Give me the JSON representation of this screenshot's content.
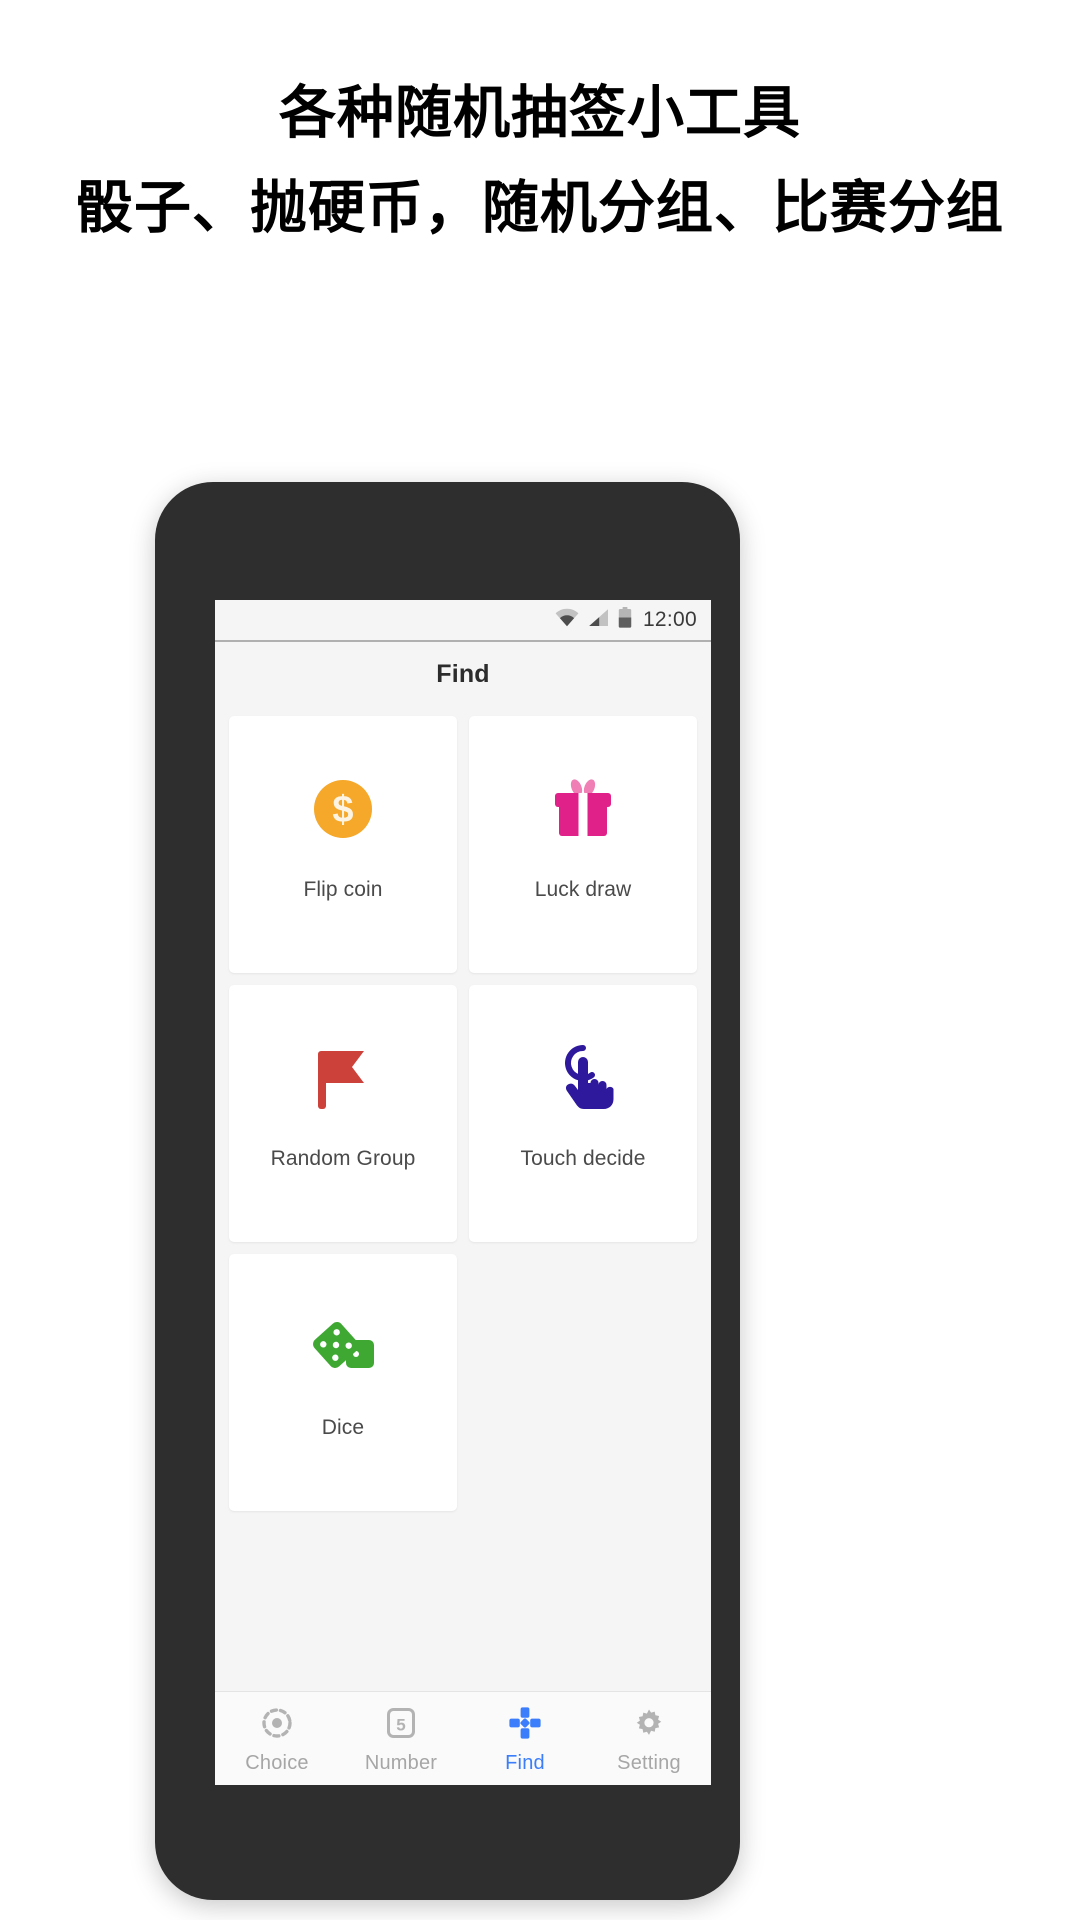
{
  "promo": {
    "line1": "各种随机抽签小工具",
    "line2": "骰子、抛硬币，随机分组、比赛分组"
  },
  "phone": {
    "statusbar": {
      "wifi_icon": "wifi-icon",
      "signal_icon": "signal-icon",
      "battery_icon": "battery-icon",
      "time": "12:00"
    },
    "appbar": {
      "title": "Find"
    },
    "grid": {
      "cards": [
        {
          "label": "Flip coin",
          "icon": "coin-dollar-icon",
          "color": "#f5a829"
        },
        {
          "label": "Luck draw",
          "icon": "gift-box-icon",
          "color": "#e0218a"
        },
        {
          "label": "Random Group",
          "icon": "flag-icon",
          "color": "#cc4139"
        },
        {
          "label": "Touch decide",
          "icon": "touch-hand-icon",
          "color": "#2e189c"
        },
        {
          "label": "Dice",
          "icon": "dice-icon",
          "color": "#3ea832"
        }
      ]
    },
    "bottomnav": {
      "active_color": "#3b7dfb",
      "inactive_color": "#a6a6a6",
      "items": [
        {
          "label": "Choice",
          "icon": "target-circle-icon",
          "active": false
        },
        {
          "label": "Number",
          "icon": "number-five-icon",
          "active": false
        },
        {
          "label": "Find",
          "icon": "dpad-icon",
          "active": true
        },
        {
          "label": "Setting",
          "icon": "gear-icon",
          "active": false
        }
      ]
    }
  }
}
